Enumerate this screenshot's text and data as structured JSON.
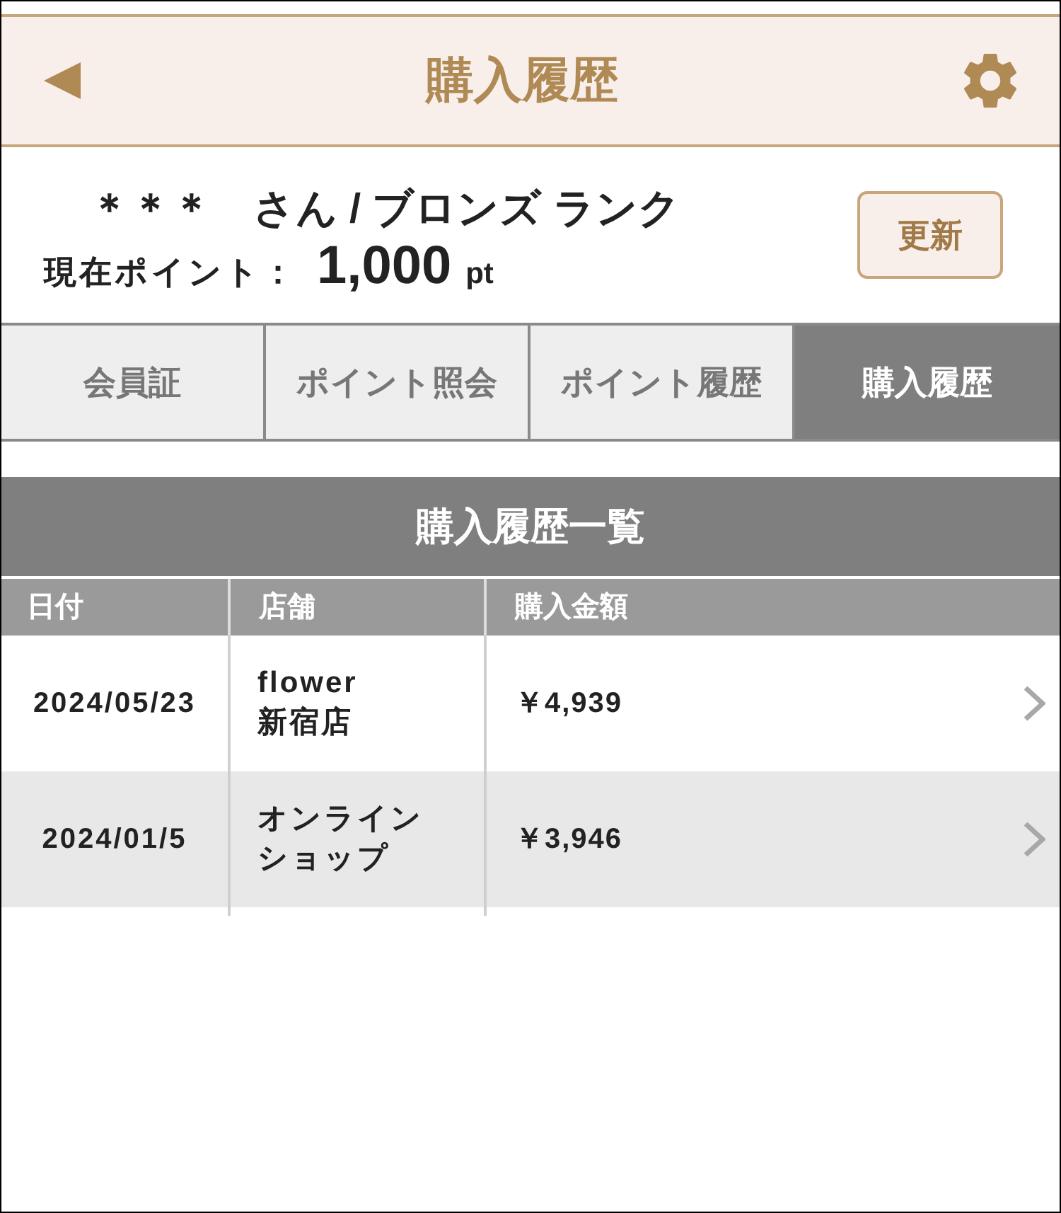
{
  "header": {
    "title": "購入履歴"
  },
  "member": {
    "name": "＊＊＊　さん / ブロンズ ランク",
    "points_label": "現在ポイント：",
    "points_value": "1,000",
    "points_unit": "pt",
    "refresh_button": "更新"
  },
  "tabs": [
    {
      "label": "会員証",
      "selected": false
    },
    {
      "label": "ポイント照会",
      "selected": false
    },
    {
      "label": "ポイント履歴",
      "selected": false
    },
    {
      "label": "購入履歴",
      "selected": true
    }
  ],
  "history": {
    "title": "購入履歴一覧",
    "columns": [
      "日付",
      "店舗",
      "購入金額"
    ],
    "rows": [
      {
        "date": "2024/05/23",
        "store": "flower\n新宿店",
        "amount": "￥4,939"
      },
      {
        "date": "2024/01/5",
        "store": "オンラインショップ",
        "amount": "￥3,946"
      }
    ]
  }
}
